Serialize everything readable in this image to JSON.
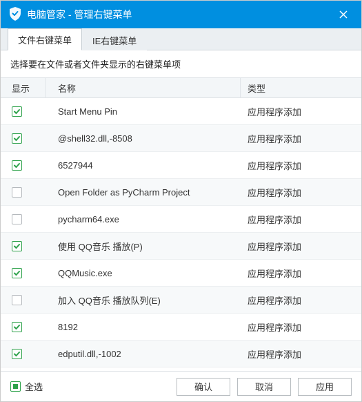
{
  "window": {
    "title": "电脑管家 - 管理右键菜单"
  },
  "tabs": [
    {
      "label": "文件右键菜单",
      "active": true
    },
    {
      "label": "IE右键菜单",
      "active": false
    }
  ],
  "instruction": "选择要在文件或者文件夹显示的右键菜单项",
  "columns": {
    "check": "显示",
    "name": "名称",
    "type": "类型"
  },
  "rows": [
    {
      "checked": true,
      "name": "Start Menu Pin",
      "type": "应用程序添加"
    },
    {
      "checked": true,
      "name": "@shell32.dll,-8508",
      "type": "应用程序添加"
    },
    {
      "checked": true,
      "name": "6527944",
      "type": "应用程序添加"
    },
    {
      "checked": false,
      "name": "Open Folder as PyCharm Project",
      "type": "应用程序添加"
    },
    {
      "checked": false,
      "name": "pycharm64.exe",
      "type": "应用程序添加"
    },
    {
      "checked": true,
      "name": "使用 QQ音乐 播放(P)",
      "type": "应用程序添加"
    },
    {
      "checked": true,
      "name": "QQMusic.exe",
      "type": "应用程序添加"
    },
    {
      "checked": false,
      "name": "加入 QQ音乐 播放队列(E)",
      "type": "应用程序添加"
    },
    {
      "checked": true,
      "name": "8192",
      "type": "应用程序添加"
    },
    {
      "checked": true,
      "name": "edputil.dll,-1002",
      "type": "应用程序添加"
    }
  ],
  "footer": {
    "selectAll": "全选",
    "ok": "确认",
    "cancel": "取消",
    "apply": "应用"
  }
}
